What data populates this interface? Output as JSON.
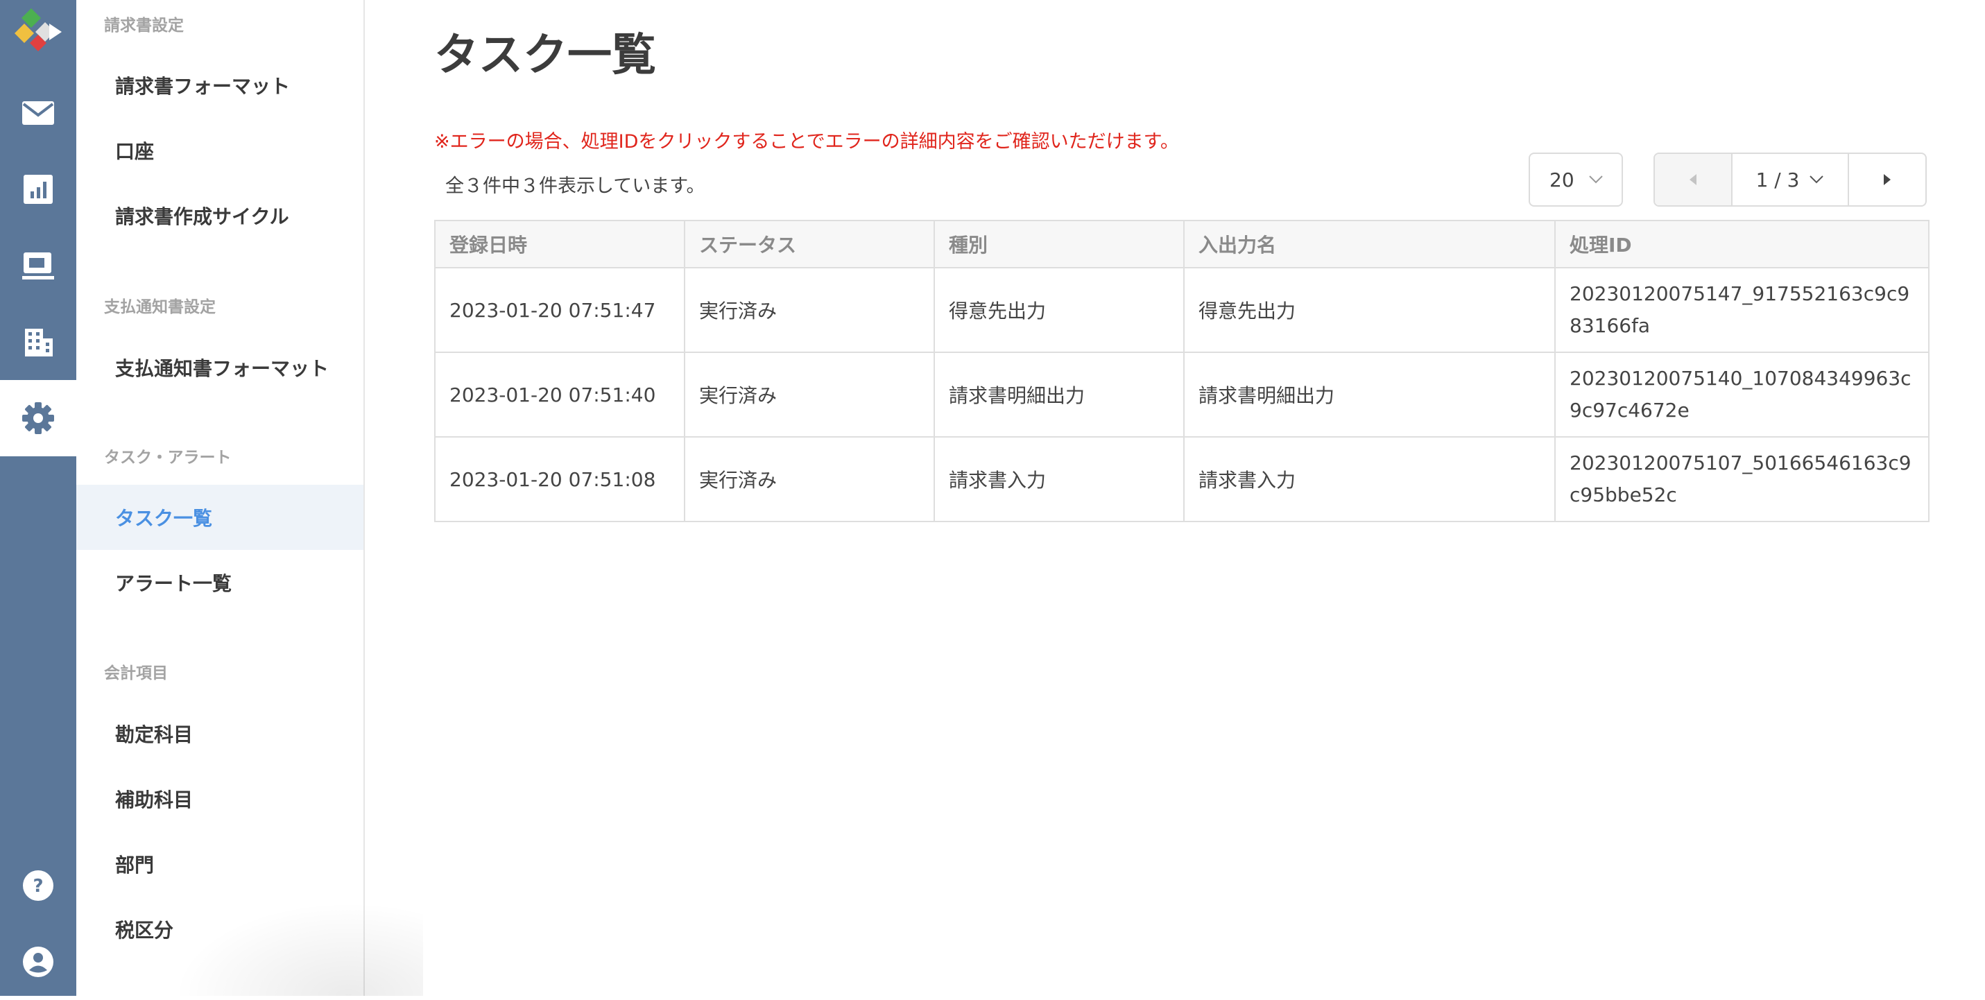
{
  "sidebar": {
    "sections": [
      {
        "heading": "請求書設定",
        "items": [
          "請求書フォーマット",
          "口座",
          "請求書作成サイクル"
        ]
      },
      {
        "heading": "支払通知書設定",
        "items": [
          "支払通知書フォーマット"
        ]
      },
      {
        "heading": "タスク・アラート",
        "items": [
          "タスク一覧",
          "アラート一覧"
        ]
      },
      {
        "heading": "会計項目",
        "items": [
          "勘定科目",
          "補助科目",
          "部門",
          "税区分"
        ]
      }
    ]
  },
  "main": {
    "title": "タスク一覧",
    "error_note": "※エラーの場合、処理IDをクリックすることでエラーの詳細内容をご確認いただけます。",
    "count_text": "全３件中３件表示しています。",
    "per_page": "20",
    "page_label": "1 / 3"
  },
  "table": {
    "headers": [
      "登録日時",
      "ステータス",
      "種別",
      "入出力名",
      "処理ID"
    ],
    "rows": [
      [
        "2023-01-20 07:51:47",
        "実行済み",
        "得意先出力",
        "得意先出力",
        "20230120075147_917552163c9c983166fa"
      ],
      [
        "2023-01-20 07:51:40",
        "実行済み",
        "請求書明細出力",
        "請求書明細出力",
        "20230120075140_107084349963c9c97c4672e"
      ],
      [
        "2023-01-20 07:51:08",
        "実行済み",
        "請求書入力",
        "請求書入力",
        "20230120075107_50166546163c9c95bbe52c"
      ]
    ]
  },
  "icons": {
    "rail": [
      "logo-icon",
      "mail-icon",
      "chart-icon",
      "payment-icon",
      "building-icon",
      "gear-icon",
      "help-icon",
      "account-icon"
    ]
  },
  "colors": {
    "rail": "#5b7799",
    "accent": "#4a90e2",
    "error": "#e0251c",
    "active_nav_bg": "#eef3f9"
  }
}
